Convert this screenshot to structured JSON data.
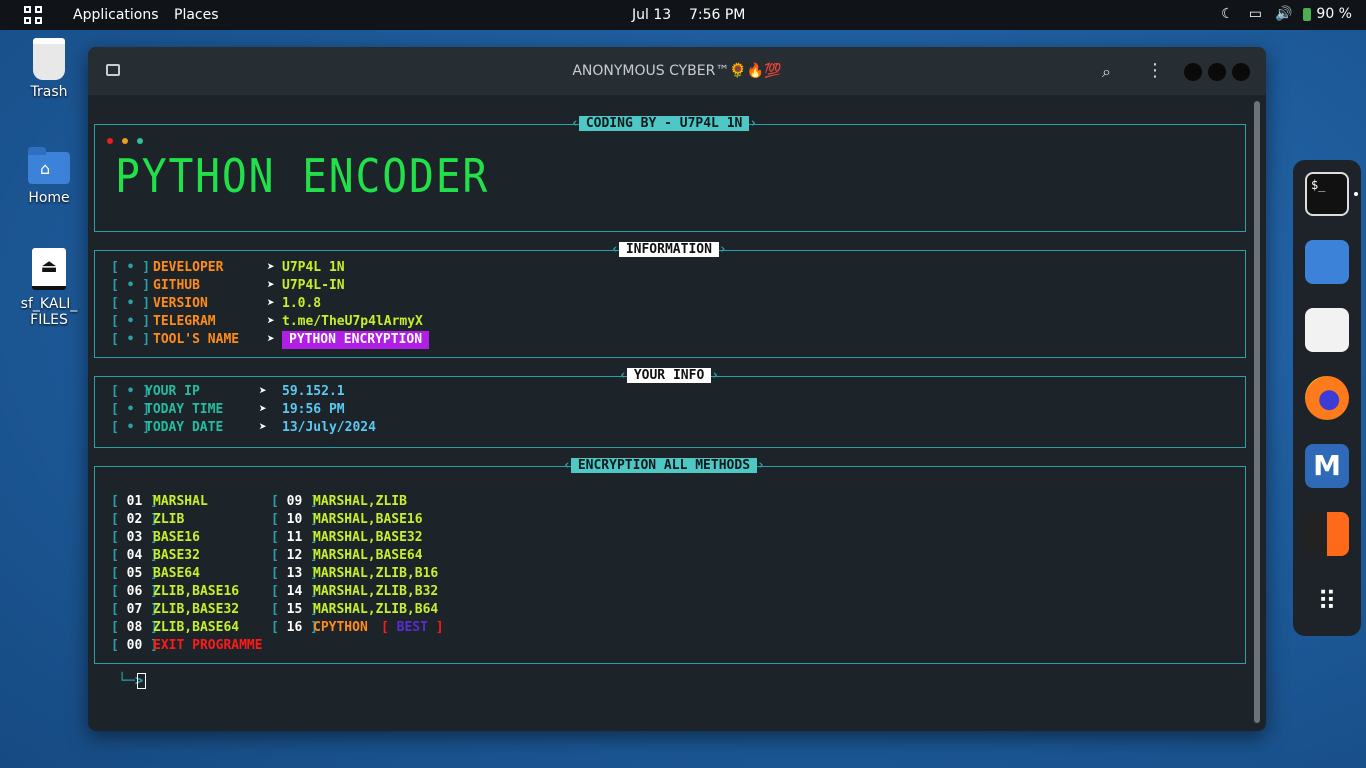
{
  "topbar": {
    "applications": "Applications",
    "places": "Places",
    "date": "Jul 13",
    "time": "7:56 PM",
    "battery": "90 %",
    "icons": [
      "apps-grid-icon",
      "night-mode-icon",
      "window-icon",
      "volume-icon",
      "battery-icon"
    ]
  },
  "desktop": {
    "trash": "Trash",
    "home": "Home",
    "drive_line1": "sf_KALI_",
    "drive_line2": "FILES"
  },
  "terminal": {
    "title": "ANONYMOUS CYBER™🌻🔥💯",
    "coding_by": "CODING BY - U7P4L 1N",
    "banner": "PYTHON ENCODER",
    "information_title": "INFORMATION",
    "info_rows": [
      {
        "bullet": "[ • ]",
        "key": "DEVELOPER",
        "arrow": "➤",
        "value": "U7P4L 1N"
      },
      {
        "bullet": "[ • ]",
        "key": "GITHUB",
        "arrow": "➤",
        "value": "U7P4L-IN"
      },
      {
        "bullet": "[ • ]",
        "key": "VERSION",
        "arrow": "➤",
        "value": "1.0.8"
      },
      {
        "bullet": "[ • ]",
        "key": "TELEGRAM",
        "arrow": "➤",
        "value": "t.me/TheU7p4lArmyX"
      },
      {
        "bullet": "[ • ]",
        "key": "TOOL'S NAME",
        "arrow": "➤",
        "value": "PYTHON ENCRYPTION"
      }
    ],
    "your_info_title": "YOUR INFO",
    "your_info_rows": [
      {
        "bullet": "[ • ]",
        "key": "YOUR IP",
        "arrow": "➤",
        "value": "59.152.1"
      },
      {
        "bullet": "[ • ]",
        "key": "TODAY TIME",
        "arrow": "➤",
        "value": "19:56 PM"
      },
      {
        "bullet": "[ • ]",
        "key": "TODAY DATE",
        "arrow": "➤",
        "value": "13/July/2024"
      }
    ],
    "methods_title": "ENCRYPTION ALL METHODS",
    "methods_left": [
      {
        "num": "01",
        "name": "MARSHAL"
      },
      {
        "num": "02",
        "name": "ZLIB"
      },
      {
        "num": "03",
        "name": "BASE16"
      },
      {
        "num": "04",
        "name": "BASE32"
      },
      {
        "num": "05",
        "name": "BASE64"
      },
      {
        "num": "06",
        "name": "ZLIB,BASE16"
      },
      {
        "num": "07",
        "name": "ZLIB,BASE32"
      },
      {
        "num": "08",
        "name": "ZLIB,BASE64"
      }
    ],
    "methods_right": [
      {
        "num": "09",
        "name": "MARSHAL,ZLIB"
      },
      {
        "num": "10",
        "name": "MARSHAL,BASE16"
      },
      {
        "num": "11",
        "name": "MARSHAL,BASE32"
      },
      {
        "num": "12",
        "name": "MARSHAL,BASE64"
      },
      {
        "num": "13",
        "name": "MARSHAL,ZLIB,B16"
      },
      {
        "num": "14",
        "name": "MARSHAL,ZLIB,B32"
      },
      {
        "num": "15",
        "name": "MARSHAL,ZLIB,B64"
      },
      {
        "num": "16",
        "name": "CPYTHON"
      }
    ],
    "best_label": "BEST",
    "exit_num": "00",
    "exit_label": "EXIT PROGRAMME",
    "prompt": "└─>"
  },
  "dock": [
    "terminal-icon",
    "files-icon",
    "text-editor-icon",
    "firefox-icon",
    "metasploit-icon",
    "burpsuite-icon",
    "show-apps-icon"
  ],
  "colors": {
    "accent": "#2ca0a6",
    "key_orange": "#ff8c1a",
    "value_lime": "#c5f02a",
    "banner_green": "#22e04a"
  }
}
